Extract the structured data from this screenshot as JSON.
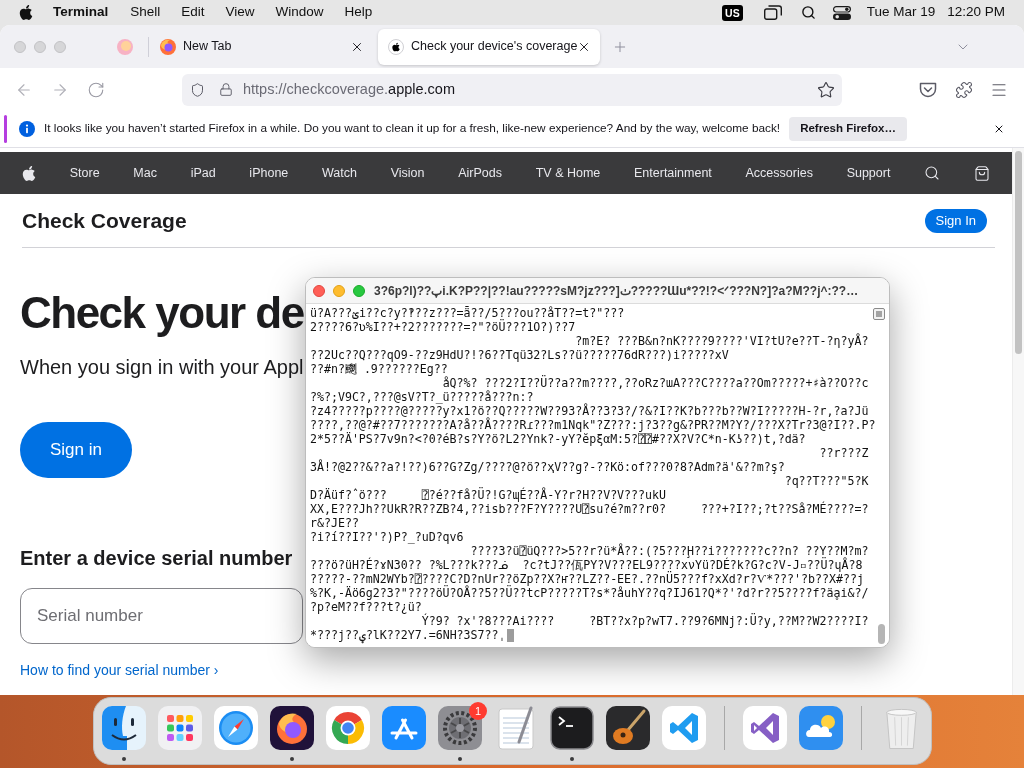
{
  "menu_bar": {
    "app": "Terminal",
    "menus": [
      "Shell",
      "Edit",
      "View",
      "Window",
      "Help"
    ],
    "input_source": "US",
    "date": "Tue Mar 19",
    "time": "12:20 PM"
  },
  "browser": {
    "tabs": [
      {
        "kind": "newtab",
        "title": "New Tab",
        "selected": false
      },
      {
        "kind": "site",
        "title": "Check your device's coverage",
        "selected": true
      }
    ],
    "address": {
      "url_prefix": "https://checkcoverage.",
      "url_domain": "apple.com"
    },
    "notification": {
      "message": "It looks like you haven’t started Firefox in a while. Do you want to clean it up for a fresh, like-new experience? And by the way, welcome back!",
      "button": "Refresh Firefox…"
    }
  },
  "page": {
    "nav": [
      "Store",
      "Mac",
      "iPad",
      "iPhone",
      "Watch",
      "Vision",
      "AirPods",
      "TV & Home",
      "Entertainment",
      "Accessories",
      "Support"
    ],
    "subheader": {
      "title": "Check Coverage",
      "button": "Sign In"
    },
    "hero": {
      "heading": "Check your de",
      "subtitle": "When you sign in with your Appl",
      "button": "Sign in"
    },
    "serial": {
      "heading": "Enter a device serial number",
      "placeholder": "Serial number",
      "link": "How to find your serial number ›"
    }
  },
  "terminal": {
    "title": "3?6p?l)??پi.K?P??|??!au?????sM?jz???]ٺ?????Ɯu*??!?<ᐟ???N?]?a?M??j^:??…",
    "lines": [
      "ü?A???ؽi??c?y?‽??z???=ǟ??/5???ou??åT??=t?\"???",
      "2????6?ʋ%I??+?2???????=?\"?öÜ???1O?)??7",
      "                                      ?m?E? ???B&n?nK????9????'VI?tU?e??T-?η?yÅ?",
      "??2Uc??Q???qO9-??z9HdU?!?6??Tqü32?Ls??ü?????76dR???)i?????xV",
      "??#n?䬟 .9??????Eg??",
      "                   åQ?%? ???2?I??Ü??a??m????,??oRz?ɯA???C????a??Om?????+♯à??O??c",
      "?%?;V9C?,???@sV?T?_ü?????å???n:?",
      "?z4?????p????@?????y?x1?ö??Q?????W??93?Å??3?3?/?&?I??K?b???b??W?I?????H-?r,?a?Jü",
      "????,??@?#??7???????A?å??Å????Rɾ???m1Nqk\"?Z???:j?3??g&?PR??M?Y?/???X?Tr?3@?I??.P?",
      "2*5??Ä'PS?7v9n?<?0?éB?s?Y?ö?L2?Ynk?-yY?ĕpξαM:5?⍰⍰#??X?V?C*n-Kʖ??)t,?dä?",
      "                                                                         ??r???Z",
      "3Å!?@2??&??a?!??)6??G?Zg/????@?ö??ҳV??g?-??Kö:of???0?8?Adm?ä'&??m?ş?",
      "                                                                    ?q??T???\"5?K",
      "D?Äüf?ˆö???     ⍰?é??få?Ü?!G?ɰÉ??Å-Y?r?H??V?V???ukU",
      "XX,E???Jh??UkR?R??ZB?4,??isb???F?Y????U⍰su?é?m??r0?     ???+?I??;?t??Så?MÉ????=?",
      "r&?JE??",
      "?i?í??I??'?)P?_?uD?qv6",
      "                       ????3?ü⍰üQ???>5??r?ü*Å??:(?5???Ḩ??i???????c??n? ??Y??M?m?",
      "???ö?üH?É?ɤN30?? ?%L???k???ᓅ  ?c?tJ??佤PY?V???EL9????xνYü?DÉ?k?G?c?V-J▫??Ü?ɥÅ?8",
      "?????-??mN2WYb?⍰????C?D?nUr??öZp??X?ҥ??LZ??-EE?.??nÜ5???f?xXd?r?Ѵ*???'?b??X#??j",
      "%?K,-Äö6g2?3?\"????öÜ?OÅ??5??Ü??tcP?????T?s*?åuhY??q?IJ61?Q*?'?d?r??5????f?äḁi&?/",
      "?p?eM??f???t?¿ü?",
      "                Ý?9? ?x'?8???Ai????     ?BT??x?p?wT7.??9?6MNj?:Ü?y,??M??W2????I?",
      "*???j??ؠ?lK??2Y7.=6NH?3S7??ˌ"
    ]
  },
  "dock": {
    "apps": [
      {
        "kind": "finder",
        "running": true
      },
      {
        "kind": "launchpad",
        "running": false
      },
      {
        "kind": "safari",
        "running": false
      },
      {
        "kind": "firefox",
        "running": true
      },
      {
        "kind": "chrome",
        "running": false
      },
      {
        "kind": "app_store",
        "running": false
      },
      {
        "kind": "settings",
        "running": true,
        "badge": "1"
      },
      {
        "kind": "textedit",
        "running": false
      },
      {
        "kind": "terminal",
        "running": true
      },
      {
        "kind": "garageband",
        "running": false
      },
      {
        "kind": "vscode",
        "running": false
      }
    ],
    "recent_apps": [
      {
        "kind": "visual_studio",
        "running": false
      },
      {
        "kind": "weather",
        "running": false
      }
    ]
  }
}
